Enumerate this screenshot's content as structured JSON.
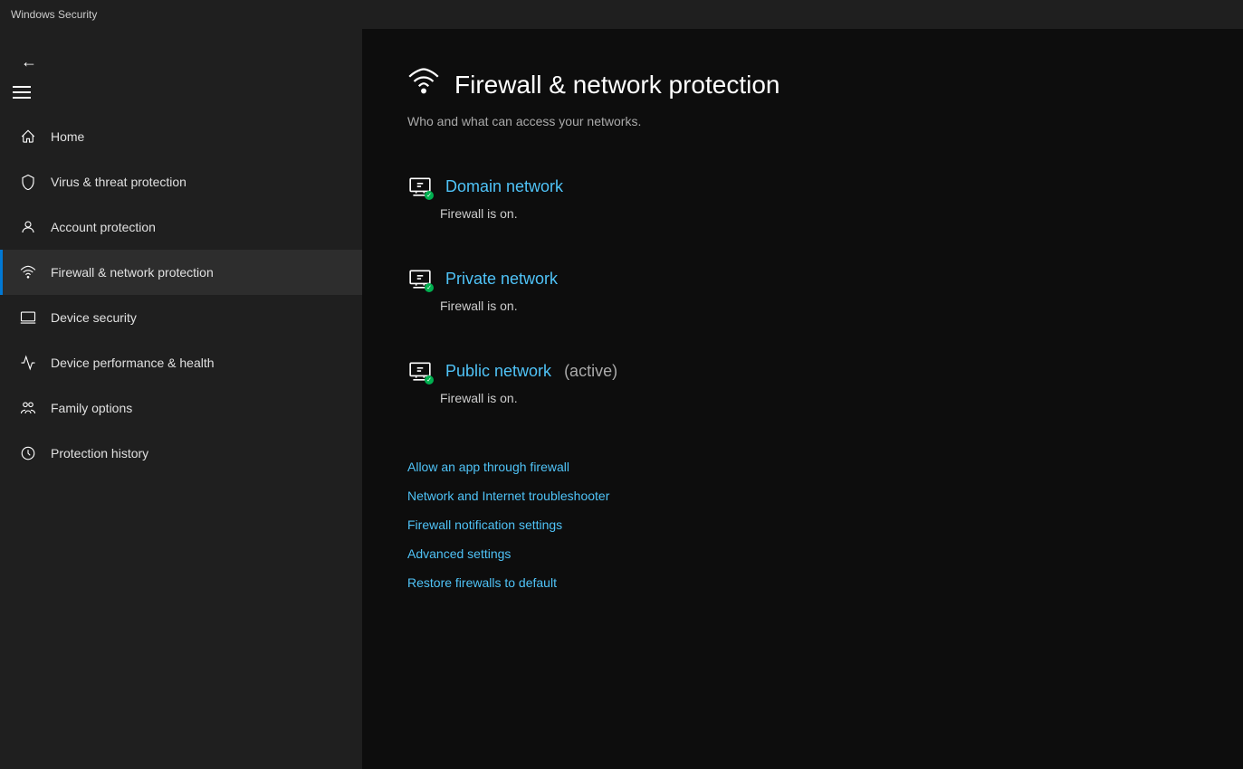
{
  "titleBar": {
    "title": "Windows Security"
  },
  "sidebar": {
    "backButton": "←",
    "navItems": [
      {
        "id": "home",
        "label": "Home",
        "icon": "home"
      },
      {
        "id": "virus",
        "label": "Virus & threat protection",
        "icon": "shield"
      },
      {
        "id": "account",
        "label": "Account protection",
        "icon": "person"
      },
      {
        "id": "firewall",
        "label": "Firewall & network protection",
        "icon": "wifi",
        "active": true
      },
      {
        "id": "device-security",
        "label": "Device security",
        "icon": "laptop"
      },
      {
        "id": "device-health",
        "label": "Device performance & health",
        "icon": "heart"
      },
      {
        "id": "family",
        "label": "Family options",
        "icon": "family"
      },
      {
        "id": "history",
        "label": "Protection history",
        "icon": "history"
      }
    ]
  },
  "content": {
    "pageIcon": "📡",
    "pageTitle": "Firewall & network protection",
    "pageSubtitle": "Who and what can access your networks.",
    "networks": [
      {
        "id": "domain",
        "name": "Domain network",
        "active": false,
        "status": "Firewall is on."
      },
      {
        "id": "private",
        "name": "Private network",
        "active": false,
        "status": "Firewall is on."
      },
      {
        "id": "public",
        "name": "Public network",
        "active": true,
        "activeBadge": "(active)",
        "status": "Firewall is on."
      }
    ],
    "links": [
      {
        "id": "allow-app",
        "label": "Allow an app through firewall"
      },
      {
        "id": "troubleshooter",
        "label": "Network and Internet troubleshooter"
      },
      {
        "id": "notification-settings",
        "label": "Firewall notification settings"
      },
      {
        "id": "advanced-settings",
        "label": "Advanced settings"
      },
      {
        "id": "restore-default",
        "label": "Restore firewalls to default"
      }
    ]
  }
}
